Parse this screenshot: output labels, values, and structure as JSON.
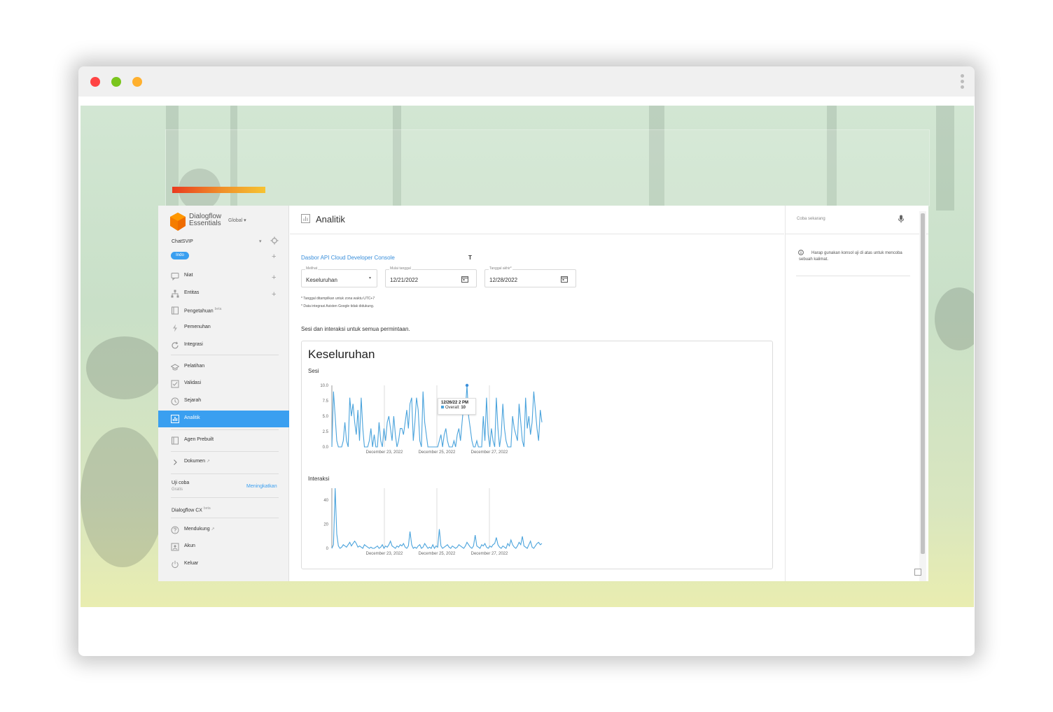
{
  "window": {
    "dots": [
      "#ff4444",
      "#7ac51d",
      "#ffb02e"
    ]
  },
  "sidebar": {
    "brand_line1": "Dialogflow",
    "brand_line2": "Essentials",
    "region": "Global ▾",
    "agent": "ChatSVIP",
    "language": "Indo",
    "items": [
      {
        "label": "Niat",
        "icon": "chat-icon"
      },
      {
        "label": "Entitas",
        "icon": "hierarchy-icon"
      },
      {
        "label": "Pengetahuan",
        "sup": "beta",
        "icon": "book-icon"
      },
      {
        "label": "Pemenuhan",
        "icon": "bolt-icon"
      },
      {
        "label": "Integrasi",
        "icon": "refresh-icon"
      },
      {
        "label": "Pelatihan",
        "icon": "graduation-cap-icon"
      },
      {
        "label": "Validasi",
        "icon": "check-box-icon"
      },
      {
        "label": "Sejarah",
        "icon": "clock-icon"
      },
      {
        "label": "Analitik",
        "icon": "chart-icon"
      },
      {
        "label": "Agen Prebuilt",
        "icon": "book-icon"
      },
      {
        "label": "Dokumen",
        "icon": "chevron-right-icon"
      }
    ],
    "trial_title": "Uji coba",
    "trial_sub": "Gratis",
    "upgrade": "Meningkatkan",
    "cx_label": "Dialogflow CX",
    "cx_sup": "beta",
    "footer_items": [
      {
        "label": "Mendukung",
        "icon": "help-icon"
      },
      {
        "label": "Akun",
        "icon": "account-icon"
      },
      {
        "label": "Keluar",
        "icon": "power-icon"
      }
    ]
  },
  "main": {
    "title": "Analitik",
    "dashboard_link": "Dasbor API Cloud Developer Console",
    "t_mark": "T",
    "fields": {
      "view_label": "Melihat",
      "view_value": "Keseluruhan",
      "start_label": "Mulai tanggal",
      "start_value": "12/21/2022",
      "end_label": "Tanggal akhir*",
      "end_value": "12/28/2022"
    },
    "note1": "* Tanggal ditampilkan untuk zona waktu UTC+7",
    "note2": "* Data integrasi Asisten Google tidak didukung.",
    "intro": "Sesi dan interaksi untuk semua permintaan.",
    "card_title": "Keseluruhan",
    "tooltip": {
      "date": "12/26/22 2 PM",
      "series": "Overall:",
      "value": "10"
    }
  },
  "right_panel": {
    "try_placeholder": "Coba sekarang",
    "info_text": "Harap gunakan konsol uji di atas untuk mencoba sebuah kalimat."
  },
  "chart_data": [
    {
      "type": "line",
      "title": "Sesi",
      "color": "#4aa3dc",
      "ylim": [
        0,
        10
      ],
      "yticks": [
        "10.0",
        "7.5",
        "5.0",
        "2.5",
        "0.0"
      ],
      "xticks": [
        "December 23, 2022",
        "December 25, 2022",
        "December 27, 2022"
      ],
      "series": [
        {
          "values": [
            0,
            9,
            5,
            1,
            0,
            0,
            0,
            1,
            4,
            1,
            0,
            8,
            5,
            7,
            4,
            2,
            6,
            1,
            8,
            3,
            0,
            0,
            0,
            1,
            3,
            0,
            2,
            0,
            0,
            4,
            1,
            0,
            3,
            1,
            4,
            5,
            3,
            1,
            5,
            2,
            0,
            1,
            3,
            3,
            2,
            4,
            6,
            3,
            7,
            8,
            1,
            4,
            8,
            6,
            1,
            0,
            9,
            4,
            2,
            0,
            0,
            0,
            0,
            0,
            0,
            0,
            1,
            2,
            0,
            2,
            3,
            1,
            0,
            0,
            0,
            1,
            0,
            2,
            3,
            1,
            4,
            7,
            6,
            10,
            5,
            3,
            1,
            0,
            0,
            1,
            0,
            0,
            0,
            5,
            1,
            8,
            2,
            0,
            3,
            1,
            0,
            8,
            3,
            0,
            2,
            7,
            3,
            1,
            0,
            0,
            0,
            5,
            3,
            2,
            1,
            7,
            4,
            1,
            0,
            8,
            3,
            5,
            2,
            4,
            9,
            6,
            3,
            1,
            6,
            4
          ]
        }
      ]
    },
    {
      "type": "line",
      "title": "Interaksi",
      "color": "#4aa3dc",
      "yticks": [
        "40",
        "20",
        "0"
      ],
      "xticks": [
        "December 23, 2022",
        "December 25, 2022",
        "December 27, 2022"
      ],
      "series": [
        {
          "values": [
            0,
            3,
            50,
            12,
            2,
            0,
            1,
            3,
            2,
            1,
            3,
            5,
            2,
            4,
            6,
            4,
            1,
            2,
            1,
            0,
            3,
            2,
            1,
            0,
            1,
            0,
            0,
            1,
            2,
            0,
            1,
            3,
            0,
            2,
            1,
            3,
            6,
            2,
            1,
            0,
            2,
            1,
            3,
            2,
            4,
            1,
            0,
            2,
            14,
            3,
            0,
            1,
            0,
            2,
            3,
            0,
            1,
            4,
            2,
            0,
            1,
            0,
            3,
            0,
            2,
            1,
            16,
            2,
            0,
            1,
            2,
            3,
            1,
            0,
            2,
            1,
            0,
            1,
            3,
            2,
            1,
            0,
            2,
            5,
            3,
            1,
            0,
            2,
            11,
            2,
            1,
            0,
            3,
            2,
            4,
            1,
            0,
            2,
            1,
            3,
            4,
            9,
            3,
            1,
            0,
            2,
            1,
            0,
            4,
            2,
            7,
            3,
            1,
            0,
            2,
            5,
            3,
            10,
            2,
            1,
            0,
            3,
            6,
            1,
            0,
            2,
            4,
            5,
            3,
            4
          ]
        }
      ]
    }
  ]
}
